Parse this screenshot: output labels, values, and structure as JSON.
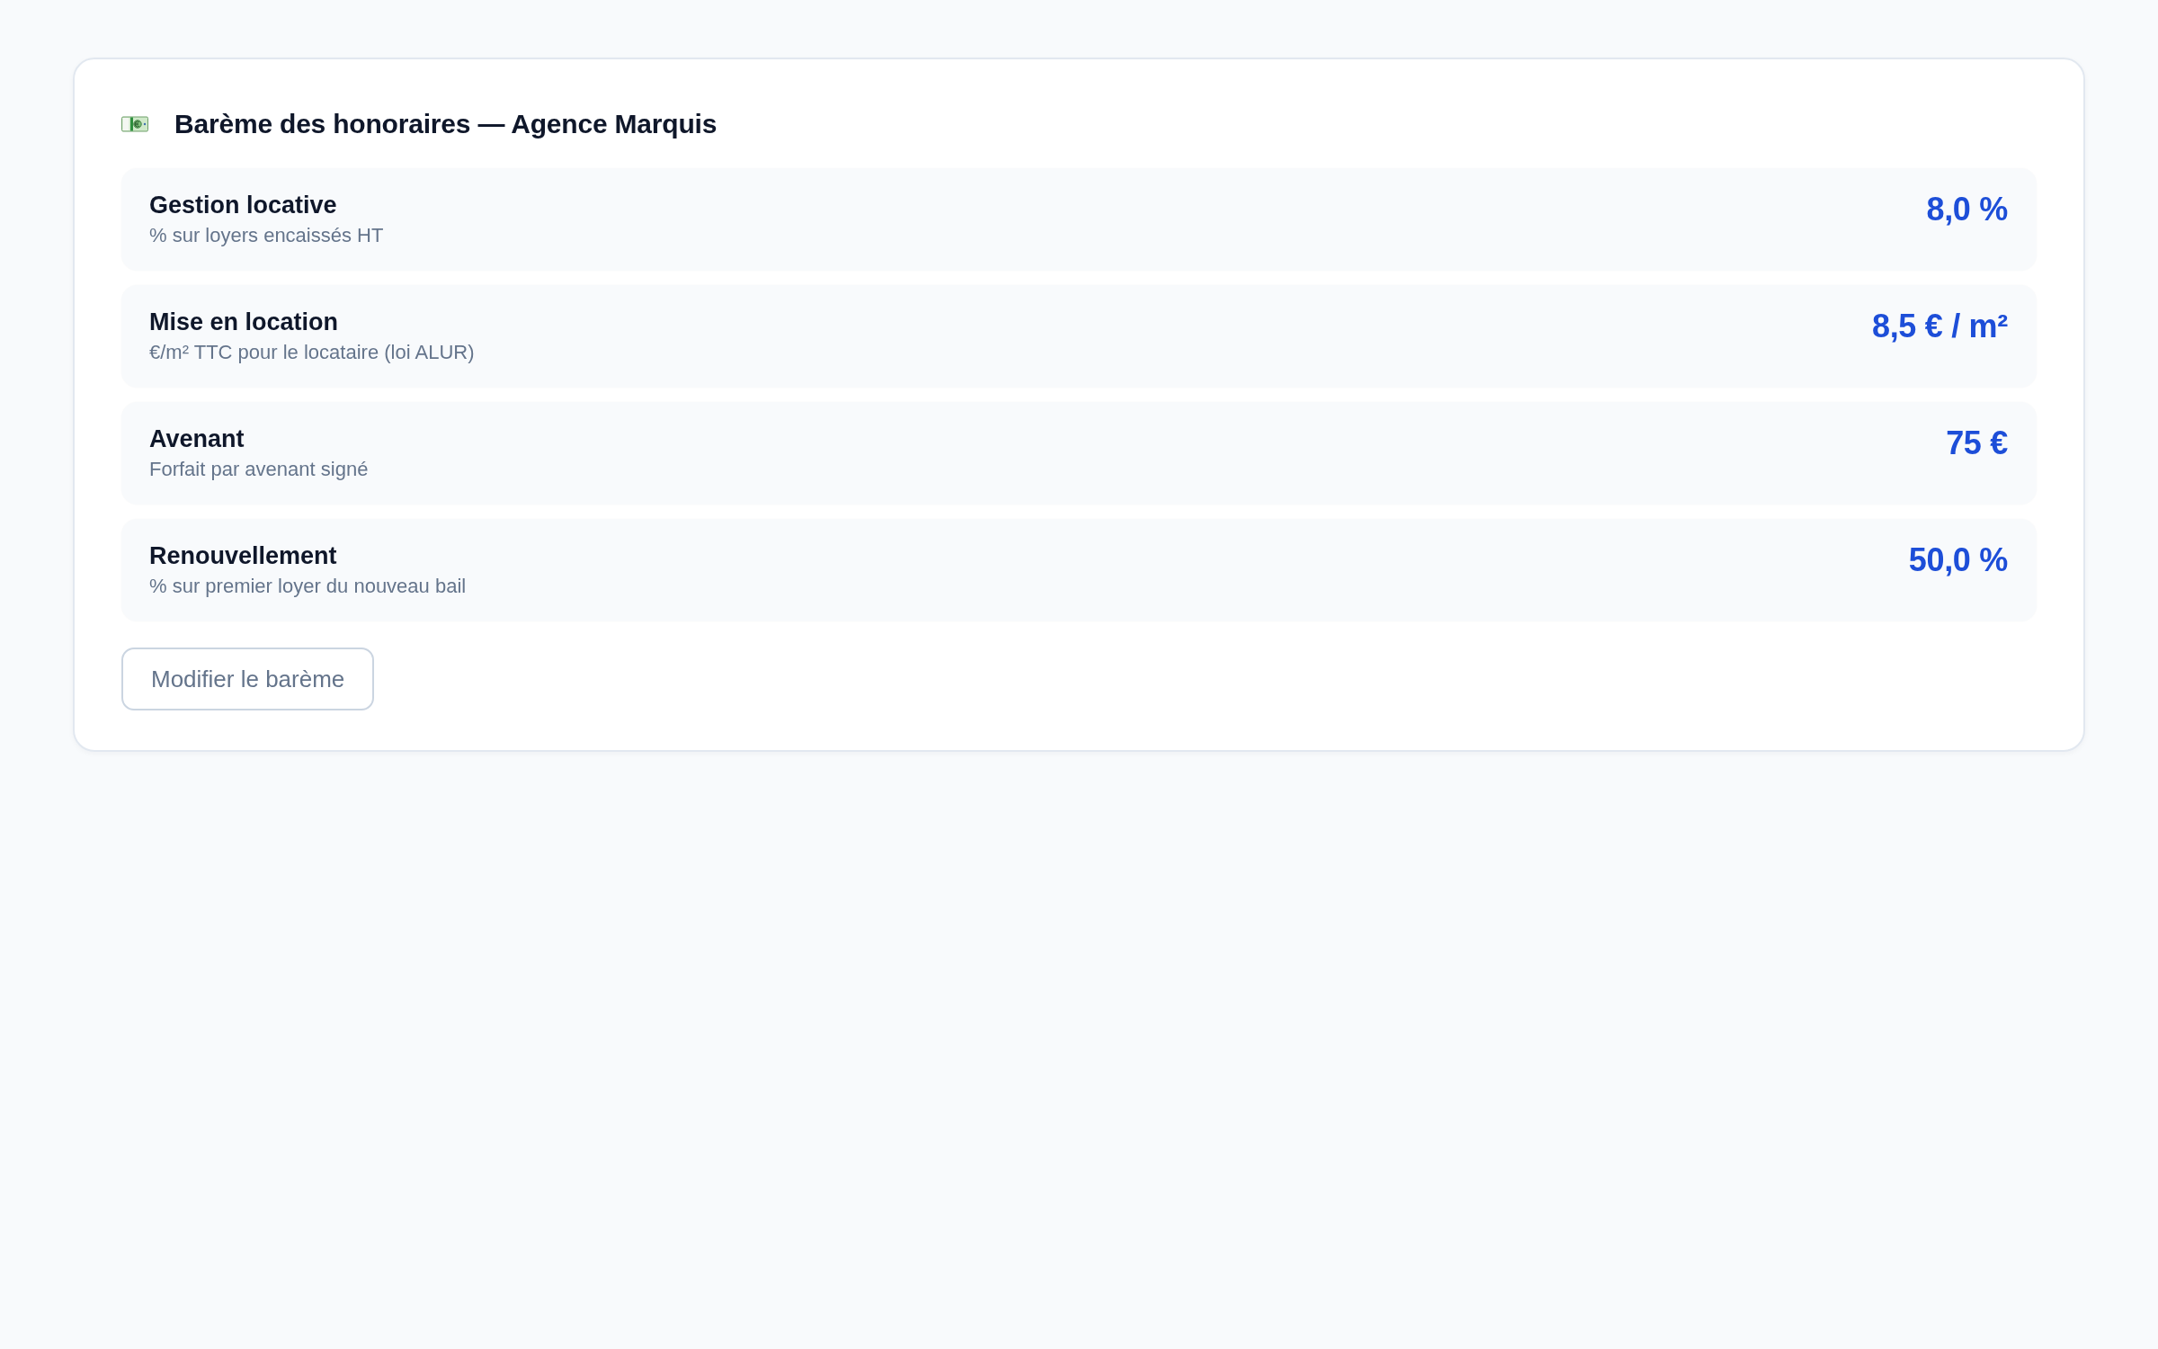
{
  "card": {
    "title": "Barème des honoraires — Agence Marquis",
    "fees": [
      {
        "label": "Gestion locative",
        "description": "% sur loyers encaissés HT",
        "value": "8,0 %"
      },
      {
        "label": "Mise en location",
        "description": "€/m² TTC pour le locataire (loi ALUR)",
        "value": "8,5 € / m²"
      },
      {
        "label": "Avenant",
        "description": "Forfait par avenant signé",
        "value": "75 €"
      },
      {
        "label": "Renouvellement",
        "description": "% sur premier loyer du nouveau bail",
        "value": "50,0 %"
      }
    ],
    "button": "Modifier le barème"
  }
}
